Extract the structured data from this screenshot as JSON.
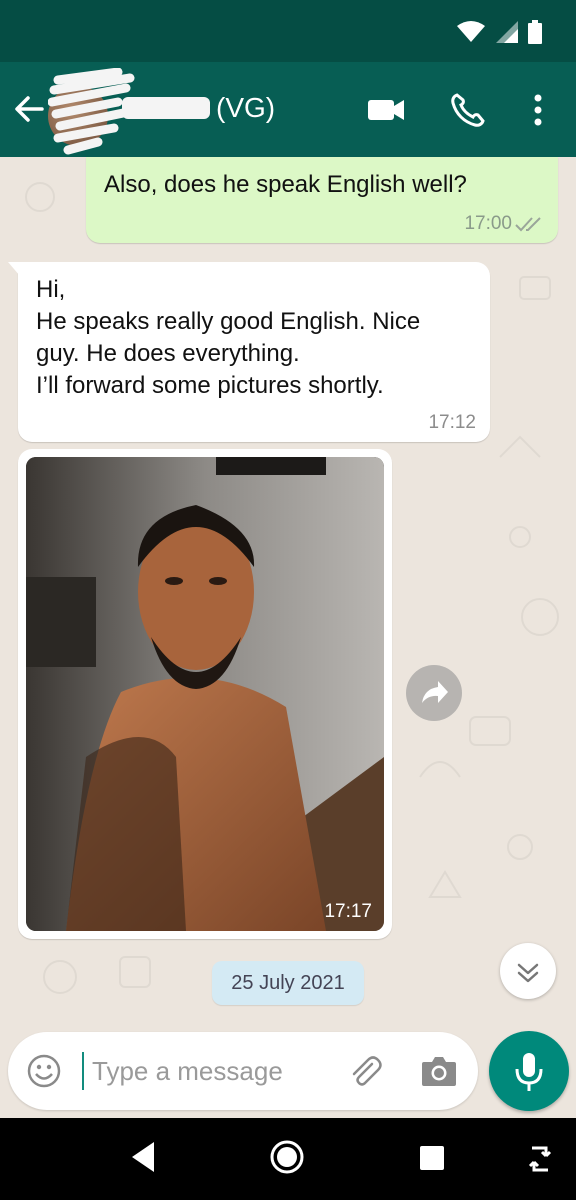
{
  "header": {
    "contact_name_visible": "(VG)",
    "icons": [
      "back-arrow-icon",
      "video-call-icon",
      "voice-call-icon",
      "more-vert-icon"
    ]
  },
  "messages": [
    {
      "direction": "out",
      "text": "Also, does he speak English well?",
      "time": "17:00",
      "status": "read"
    },
    {
      "direction": "in",
      "lines": [
        "Hi,",
        "He speaks really good English. Nice",
        "guy. He does everything.",
        "I’ll forward some pictures shortly."
      ],
      "time": "17:12"
    },
    {
      "direction": "in",
      "type": "photo",
      "time": "17:17"
    }
  ],
  "date_chip": "25 July 2021",
  "composer": {
    "placeholder": "Type a message",
    "value": ""
  },
  "colors": {
    "header": "#075E54",
    "status_bar": "#054D44",
    "outgoing_bubble": "#DCF8C6",
    "incoming_bubble": "#FFFFFF",
    "chat_bg": "#ECE5DD",
    "accent": "#00897B",
    "date_chip": "#D4EAF4"
  }
}
